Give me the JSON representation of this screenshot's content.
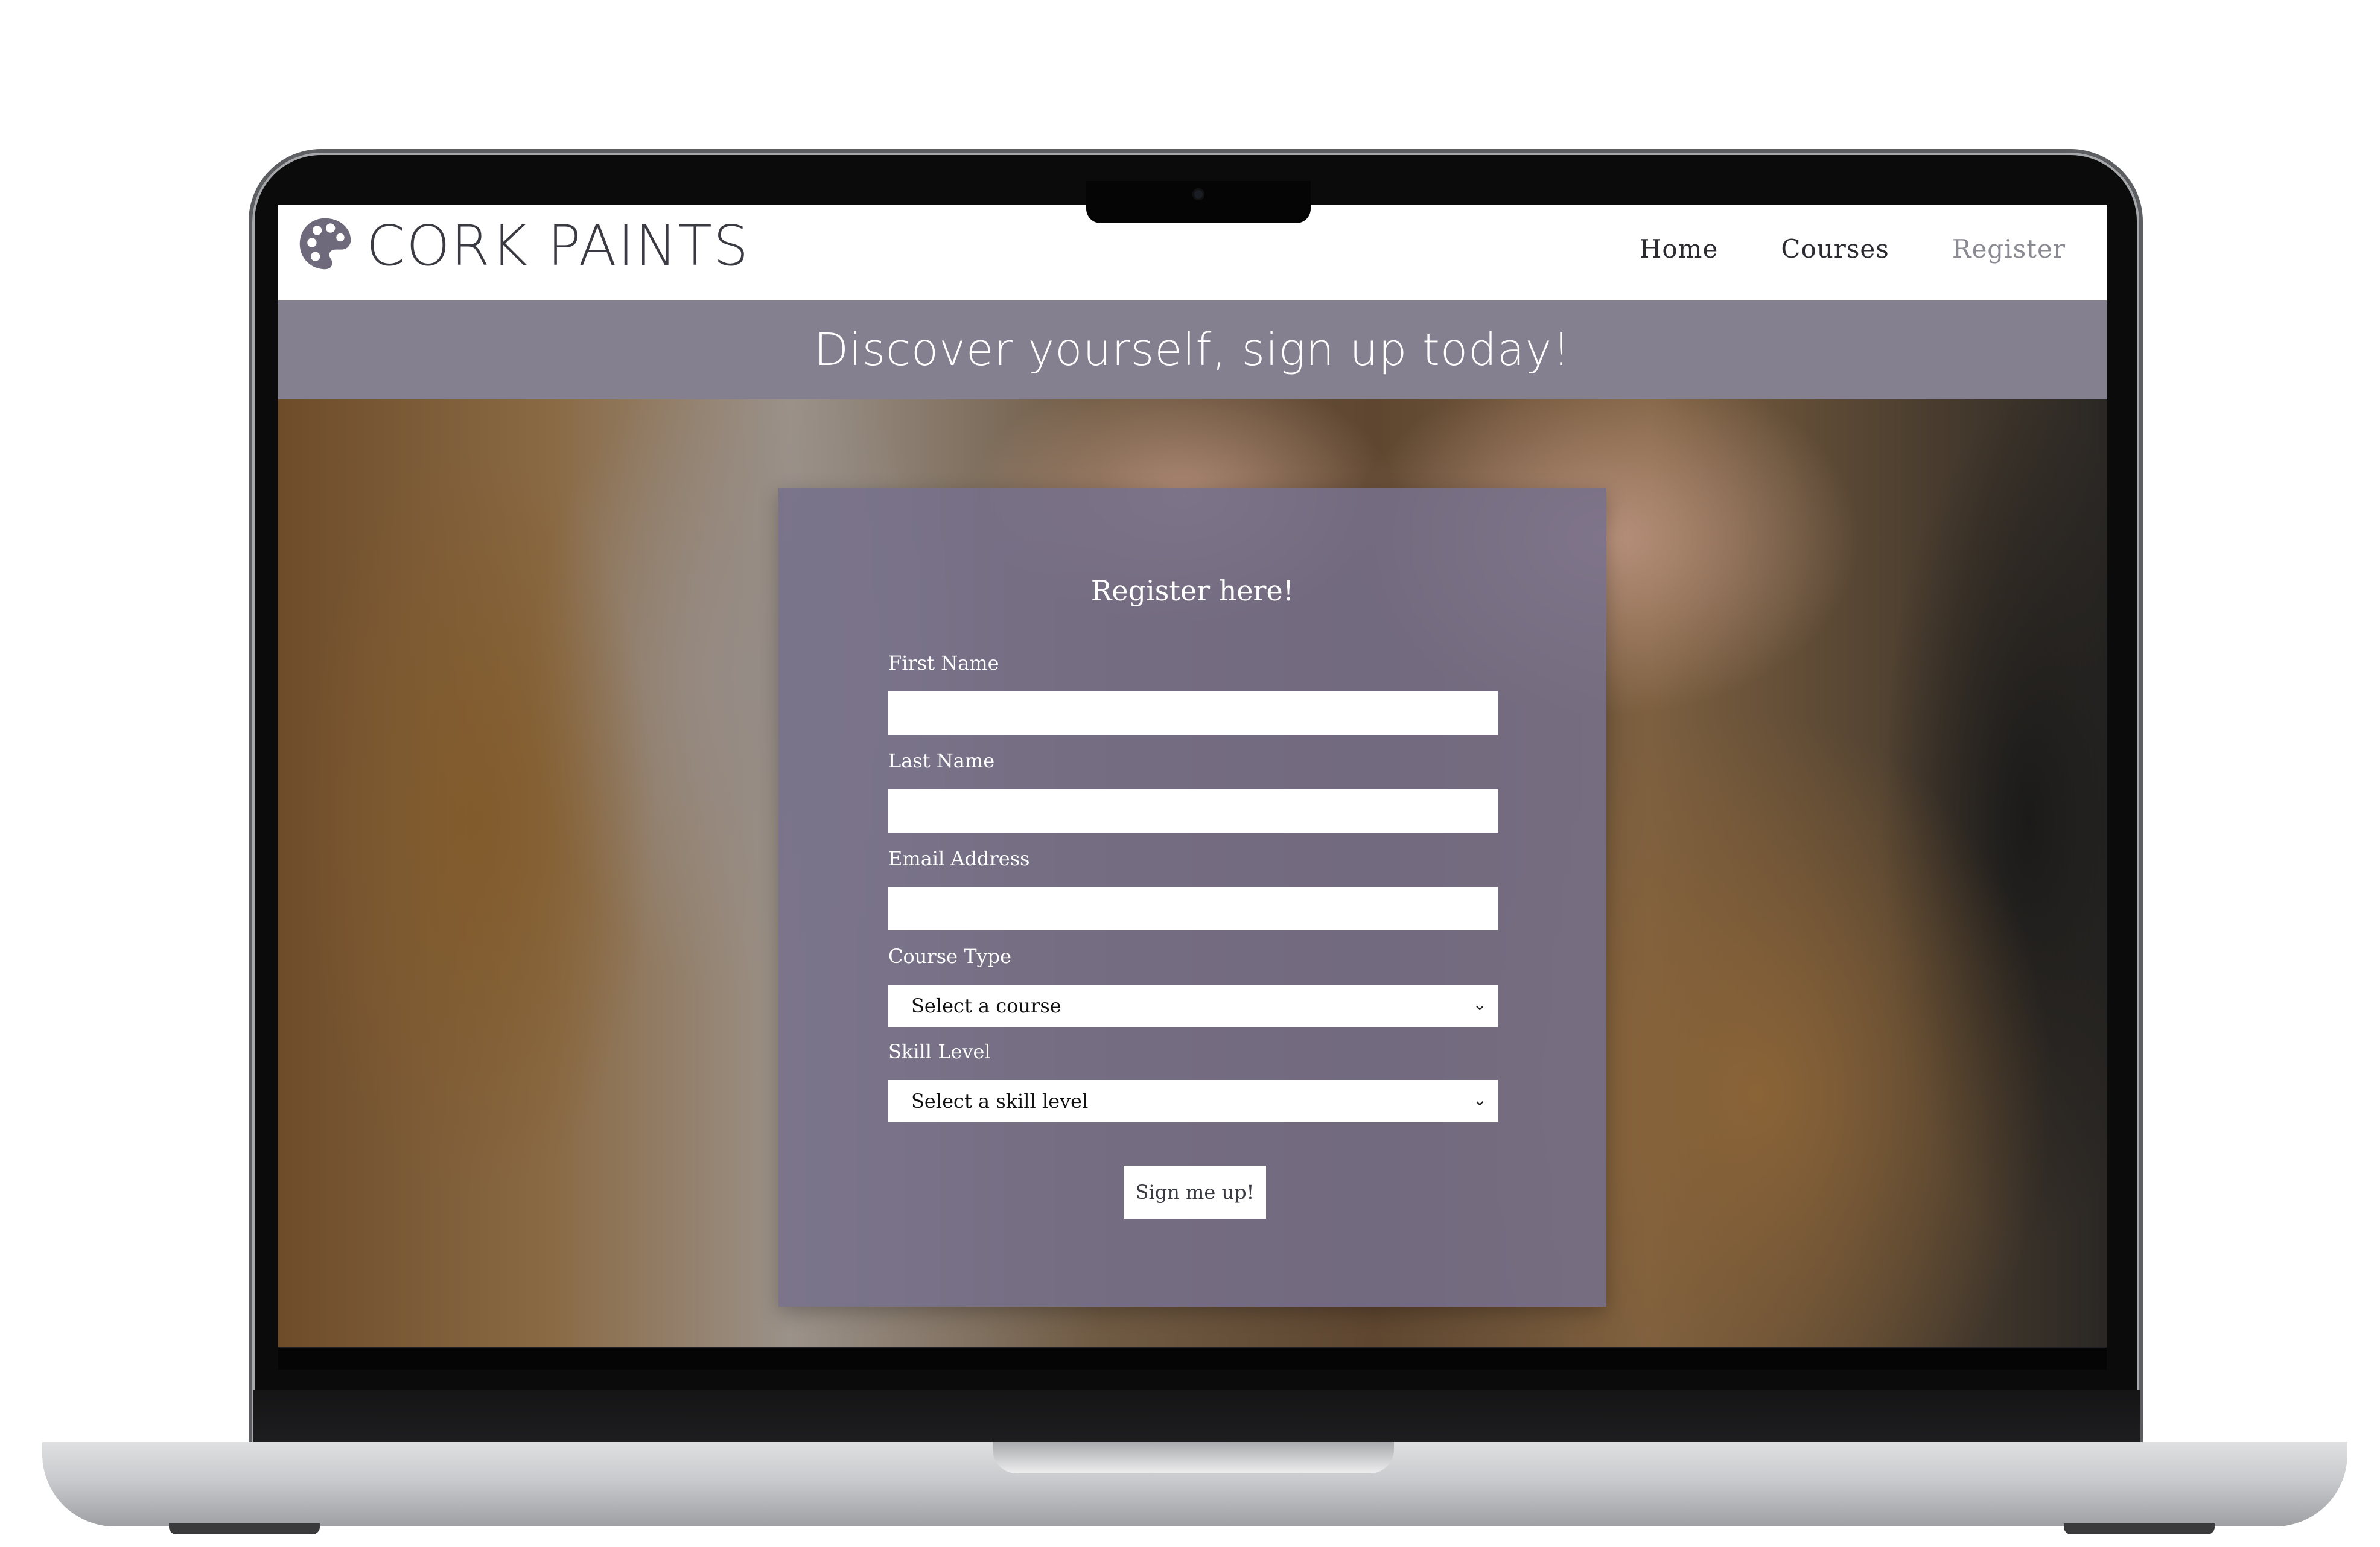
{
  "header": {
    "brand": "CORK PAINTS",
    "nav": [
      {
        "label": "Home"
      },
      {
        "label": "Courses"
      },
      {
        "label": "Register"
      }
    ]
  },
  "banner": {
    "title": "Discover yourself, sign up today!"
  },
  "form": {
    "title": "Register here!",
    "first_name": {
      "label": "First Name",
      "value": ""
    },
    "last_name": {
      "label": "Last Name",
      "value": ""
    },
    "email": {
      "label": "Email Address",
      "value": ""
    },
    "course_type": {
      "label": "Course Type",
      "selected": "Select a course"
    },
    "skill_level": {
      "label": "Skill Level",
      "selected": "Select a skill level"
    },
    "submit_label": "Sign me up!"
  },
  "colors": {
    "banner": "#84808f",
    "card": "#76708c",
    "logo": "#6e6a7c"
  },
  "icons": {
    "logo": "palette-icon",
    "select_arrow": "chevron-down-icon"
  }
}
